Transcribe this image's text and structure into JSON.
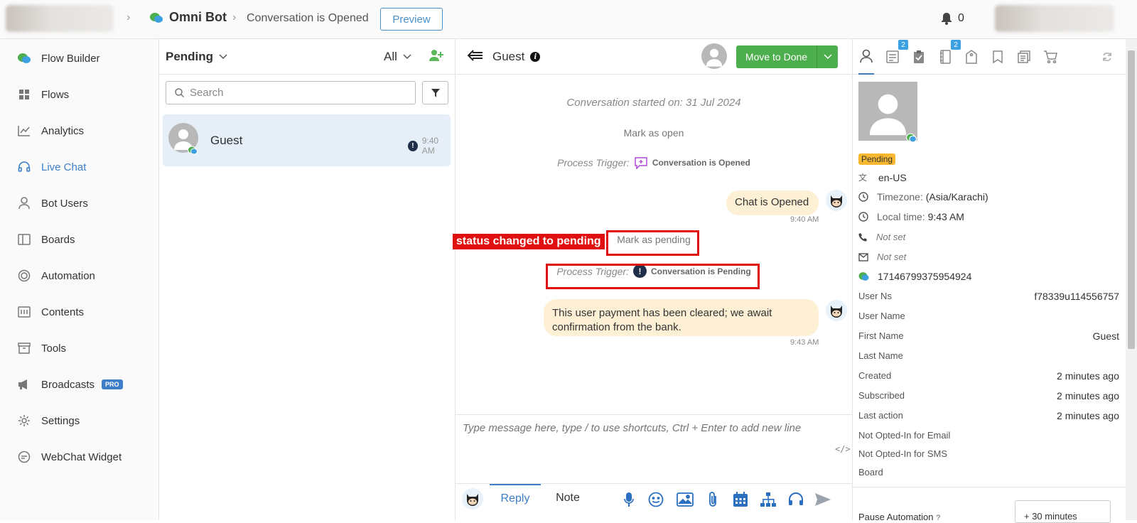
{
  "topbar": {
    "bot_name": "Omni Bot",
    "conversation_title": "Conversation is Opened",
    "preview_label": "Preview",
    "notification_count": "0"
  },
  "sidebar": {
    "items": [
      {
        "label": "Flow Builder",
        "icon": "flow-builder-icon"
      },
      {
        "label": "Flows",
        "icon": "grid-icon"
      },
      {
        "label": "Analytics",
        "icon": "chart-icon"
      },
      {
        "label": "Live Chat",
        "icon": "headset-icon"
      },
      {
        "label": "Bot Users",
        "icon": "user-icon"
      },
      {
        "label": "Boards",
        "icon": "board-icon"
      },
      {
        "label": "Automation",
        "icon": "automation-icon"
      },
      {
        "label": "Contents",
        "icon": "contents-icon"
      },
      {
        "label": "Tools",
        "icon": "tools-icon"
      },
      {
        "label": "Broadcasts",
        "icon": "megaphone-icon"
      },
      {
        "label": "Settings",
        "icon": "gear-icon"
      },
      {
        "label": "WebChat Widget",
        "icon": "chat-bubble-icon"
      }
    ],
    "active": "Live Chat",
    "pro_badge": "PRO",
    "accent_color": "#3d7ec6"
  },
  "list": {
    "filter_label": "Pending",
    "scope_label": "All",
    "search_placeholder": "Search",
    "conversations": [
      {
        "name": "Guest",
        "time": "9:40 AM"
      }
    ]
  },
  "chat": {
    "title": "Guest",
    "move_to_done": "Move to Done",
    "conversation_started": "Conversation started on: 31 Jul 2024",
    "mark_open": "Mark as open",
    "trigger1_label": "Process Trigger:",
    "trigger1_event": "Conversation is Opened",
    "msg1_text": "Chat is Opened",
    "msg1_time": "9:40 AM",
    "annotation_label": "status changed to pending",
    "mark_pending": "Mark as pending",
    "trigger2_label": "Process Trigger:",
    "trigger2_event": "Conversation is Pending",
    "msg2_text": "This user payment has been cleared; we await confirmation from the bank.",
    "msg2_time": "9:43 AM",
    "composer_placeholder": "Type message here, type / to use shortcuts, Ctrl + Enter to add new line",
    "code_toggle": "</>",
    "tab_reply": "Reply",
    "tab_note": "Note"
  },
  "profile": {
    "status": "Pending",
    "locale": "en-US",
    "timezone_label": "Timezone:",
    "timezone_value": "(Asia/Karachi)",
    "localtime_label": "Local time:",
    "localtime_value": "9:43 AM",
    "phone": "Not set",
    "email": "Not set",
    "user_id": "17146799375954924",
    "fields": [
      {
        "key": "User Ns",
        "value": "f78339u114556757"
      },
      {
        "key": "User Name",
        "value": ""
      },
      {
        "key": "First Name",
        "value": "Guest"
      },
      {
        "key": "Last Name",
        "value": ""
      },
      {
        "key": "Created",
        "value": "2 minutes ago"
      },
      {
        "key": "Subscribed",
        "value": "2 minutes ago"
      },
      {
        "key": "Last action",
        "value": "2 minutes ago"
      },
      {
        "key": "Not Opted-In for Email",
        "value": ""
      },
      {
        "key": "Not Opted-In for SMS",
        "value": ""
      },
      {
        "key": "Board",
        "value": ""
      }
    ],
    "pause_label": "Pause Automation",
    "pause_value": "+ 30 minutes",
    "tab_badges": [
      "2",
      "2"
    ]
  }
}
